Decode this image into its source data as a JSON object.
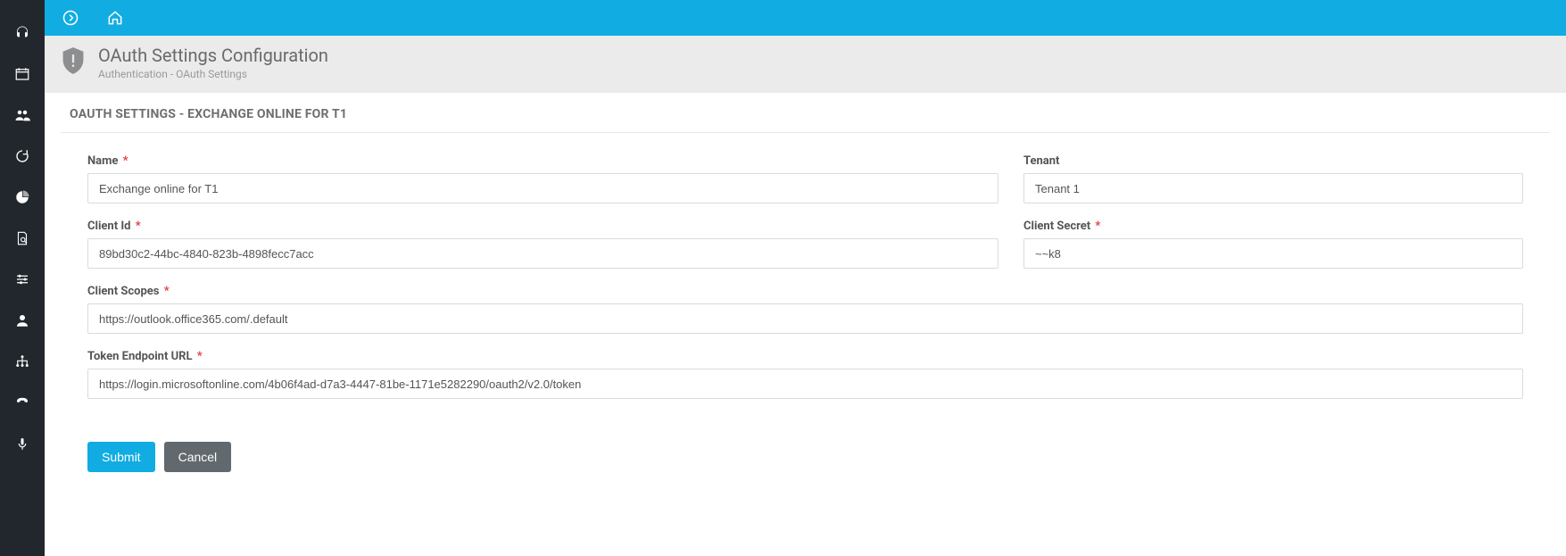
{
  "page": {
    "title": "OAuth Settings Configuration",
    "breadcrumb": "Authentication - OAuth Settings",
    "section_heading": "OAUTH SETTINGS - EXCHANGE ONLINE FOR T1"
  },
  "form": {
    "labels": {
      "name": "Name",
      "tenant": "Tenant",
      "client_id": "Client Id",
      "client_secret": "Client Secret",
      "client_scopes": "Client Scopes",
      "token_endpoint": "Token Endpoint URL"
    },
    "values": {
      "name": "Exchange online for T1",
      "tenant": "Tenant 1",
      "client_id": "89bd30c2-44bc-4840-823b-4898fecc7acc",
      "client_secret": "~~k8",
      "client_scopes": "https://outlook.office365.com/.default",
      "token_endpoint": "https://login.microsoftonline.com/4b06f4ad-d7a3-4447-81be-1171e5282290/oauth2/v2.0/token"
    }
  },
  "buttons": {
    "submit": "Submit",
    "cancel": "Cancel"
  }
}
